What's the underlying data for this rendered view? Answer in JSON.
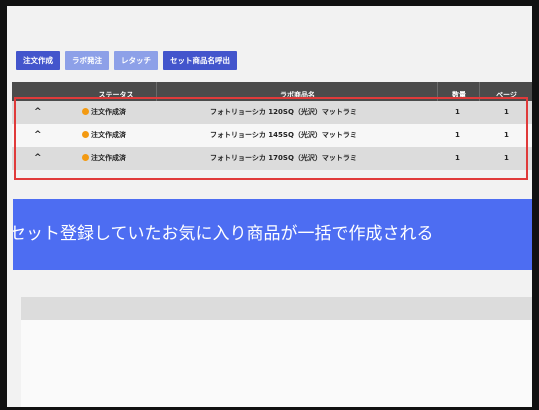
{
  "toolbar": {
    "buttons": [
      {
        "label": "注文作成",
        "style": "primary"
      },
      {
        "label": "ラボ発注",
        "style": "muted"
      },
      {
        "label": "レタッチ",
        "style": "muted"
      },
      {
        "label": "セット商品名呼出",
        "style": "primary"
      }
    ]
  },
  "table": {
    "columns": [
      "",
      "ステータス",
      "ラボ商品名",
      "数量",
      "ページ"
    ],
    "rows": [
      {
        "chevron": "^",
        "status": "注文作成済",
        "product": "フォトリョーシカ 120SQ（光沢）マットラミ",
        "qty": "1",
        "pages": "1"
      },
      {
        "chevron": "^",
        "status": "注文作成済",
        "product": "フォトリョーシカ 145SQ（光沢）マットラミ",
        "qty": "1",
        "pages": "1"
      },
      {
        "chevron": "^",
        "status": "注文作成済",
        "product": "フォトリョーシカ 170SQ（光沢）マットラミ",
        "qty": "1",
        "pages": "1"
      }
    ]
  },
  "banner": {
    "text": "セット登録していたお気に入り商品が一括で作成される"
  },
  "colors": {
    "primary": "#4355cc",
    "muted": "#8da0e8",
    "highlight_box": "#e03a3a",
    "status_dot": "#f39a12",
    "banner": "#4d6df2"
  }
}
